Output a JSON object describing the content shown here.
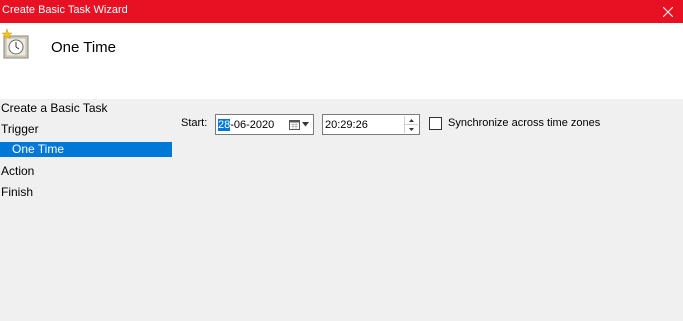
{
  "window": {
    "title": "Create Basic Task Wizard",
    "close_glyph": "✕"
  },
  "header": {
    "title": "One Time",
    "icon": "scheduled-task-clock-icon"
  },
  "sidebar": {
    "items": [
      {
        "label": "Create a Basic Task",
        "active": false
      },
      {
        "label": "Trigger",
        "active": false
      },
      {
        "label": "One Time",
        "active": true
      },
      {
        "label": "Action",
        "active": false
      },
      {
        "label": "Finish",
        "active": false
      }
    ]
  },
  "trigger": {
    "start_label": "Start:",
    "date_selected_part": "28",
    "date_rest": "-06-2020",
    "time_value": "20:29:26",
    "sync_label": "Synchronize across time zones",
    "sync_checked": false
  },
  "colors": {
    "titlebar": "#e81123",
    "selection": "#0078d7"
  }
}
